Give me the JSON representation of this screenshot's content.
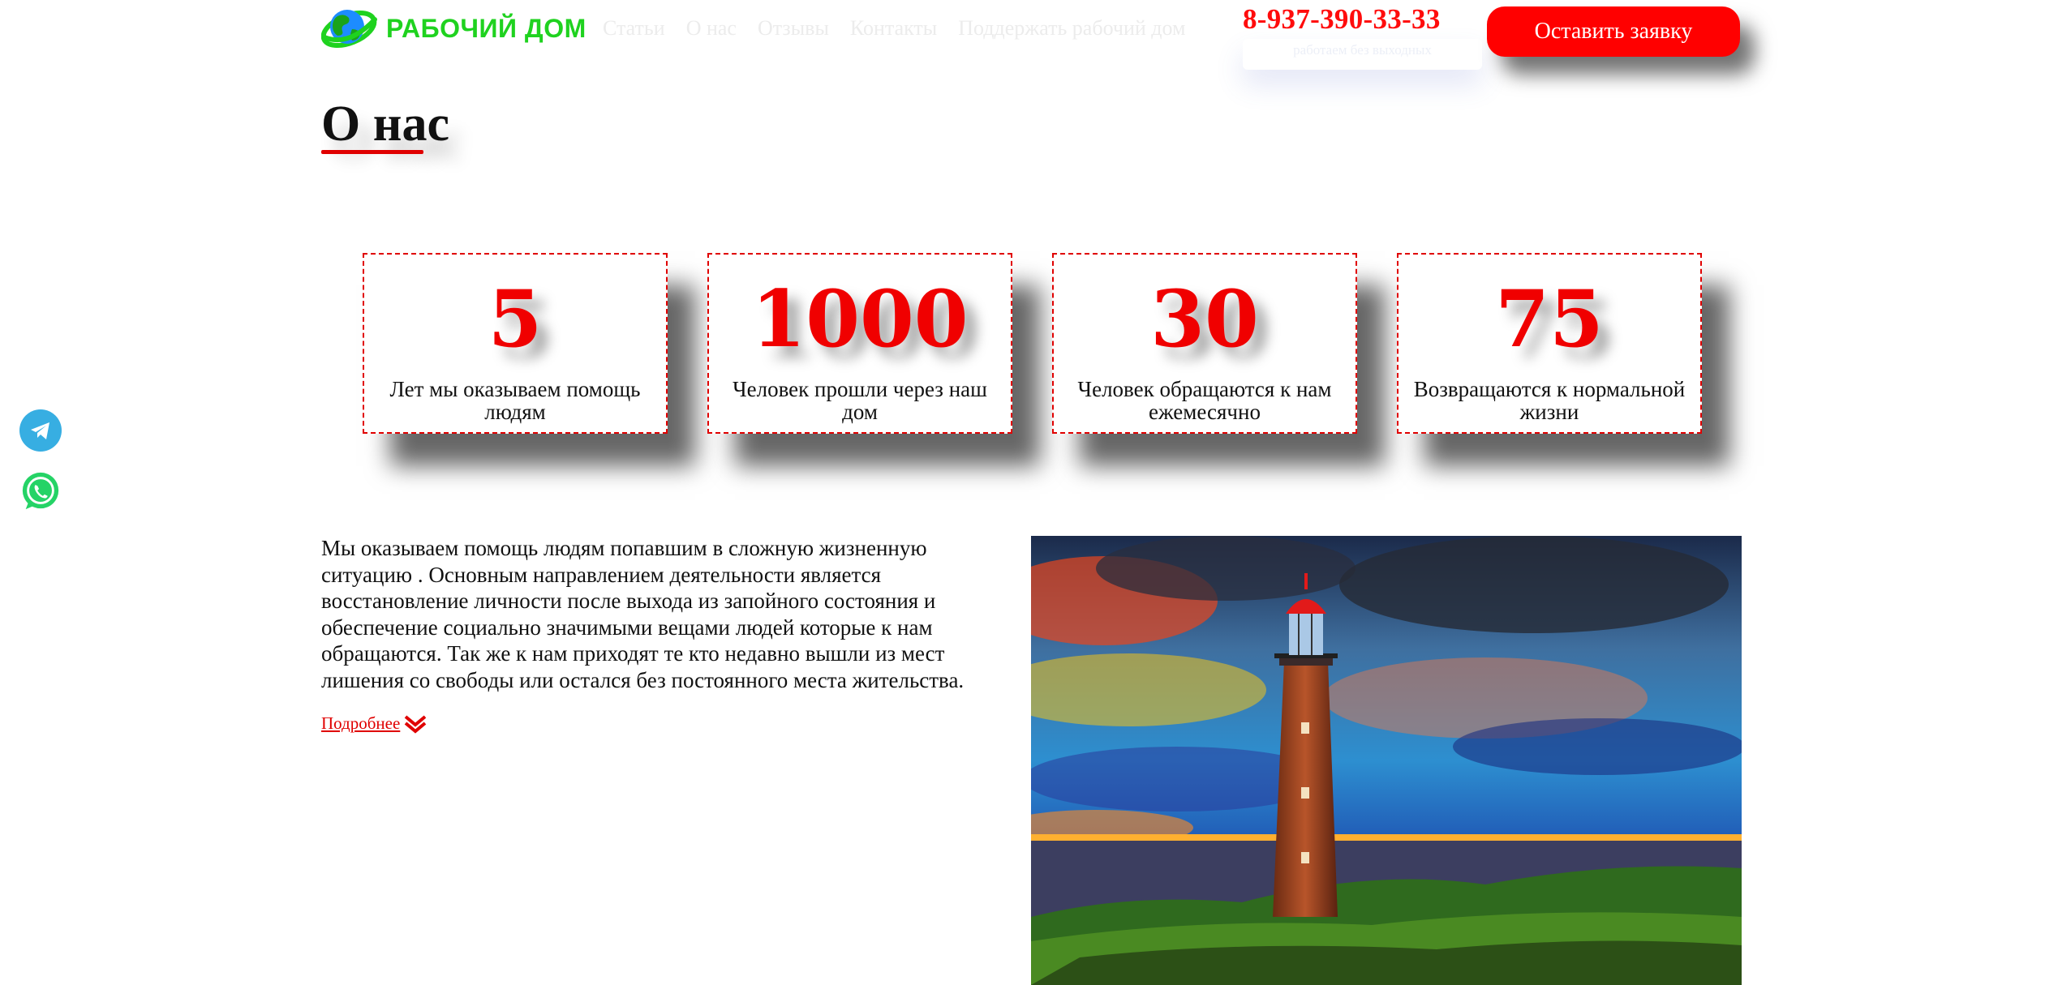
{
  "header": {
    "logo_text": "РАБОЧИЙ ДОМ",
    "nav": [
      "Статьи",
      "О нас",
      "Отзывы",
      "Контакты",
      "Поддержать рабочий дом"
    ],
    "phone": "8-937-390-33-33",
    "phone_note": "работаем без выходных",
    "cta_label": "Оставить заявку"
  },
  "messengers": [
    {
      "name": "Telegram",
      "icon": "telegram-icon"
    },
    {
      "name": "WhatsApp",
      "icon": "whatsapp-icon"
    }
  ],
  "page_title": "О нас",
  "stats": [
    {
      "value": "5",
      "label": "Лет мы оказываем помощь людям"
    },
    {
      "value": "1000",
      "label": "Человек прошли через наш дом"
    },
    {
      "value": "30",
      "label": "Человек обращаются к нам ежемесячно"
    },
    {
      "value": "75",
      "label": "Возвращаются к нормальной жизни"
    }
  ],
  "about": {
    "text": "Мы оказываем помощь людям попавшим в сложную жизненную ситуацию . Основным направлением деятельности является восстановление личности после выхода из запойного состояния и обеспечение социально значимыми вещами людей которые к нам обращаются. Так же к нам приходят те кто недавно вышли из мест лишения со свободы или остался без постоянного места жительства.",
    "more_label": "Подробнее",
    "image_subject": "lighthouse"
  },
  "colors": {
    "accent": "#ff0000",
    "logo_green": "#1fd21f",
    "telegram": "#37aee2",
    "whatsapp": "#25d366"
  }
}
